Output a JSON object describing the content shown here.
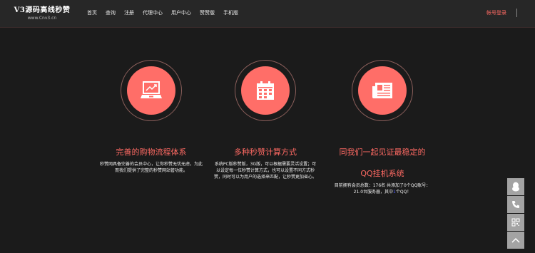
{
  "header": {
    "logo_title": "V3源码高线秒赞",
    "logo_subtitle": "www.Cnv3.cn",
    "nav": [
      "首页",
      "查询",
      "注册",
      "代理中心",
      "用户中心",
      "赞赞版",
      "手机版"
    ],
    "right_link": "帐号登录"
  },
  "features": [
    {
      "icon": "laptop-chart-icon",
      "title": "完善的购物流程体系",
      "desc": "秒赞网具备完善的会员中心，让你秒赞无忧无虑，为此而我们提供了完整的秒赞网站管功能。"
    },
    {
      "icon": "calendar-icon",
      "title": "多种秒赞计算方式",
      "desc": "系统PC版秒赞版，3G版，可以根据需要灵活设置；可以设定每一位秒赞计算方式，也可以设置不同方式秒赞，同时可以为用户的选择来匹配，让秒赞更加省心。"
    },
    {
      "icon": "newspaper-icon",
      "title_line1": "同我们一起见证最稳定的",
      "title_line2": "QQ挂机系统",
      "stats_prefix": "目前拥有会员总数：176名 共添加了0个QQ账号：21.0台服务器，其中",
      "stats_count": "1",
      "stats_suffix": "个QQ！"
    }
  ],
  "colors": {
    "accent": "#ff6e68",
    "background": "#1b1b1b",
    "header": "#272727"
  }
}
